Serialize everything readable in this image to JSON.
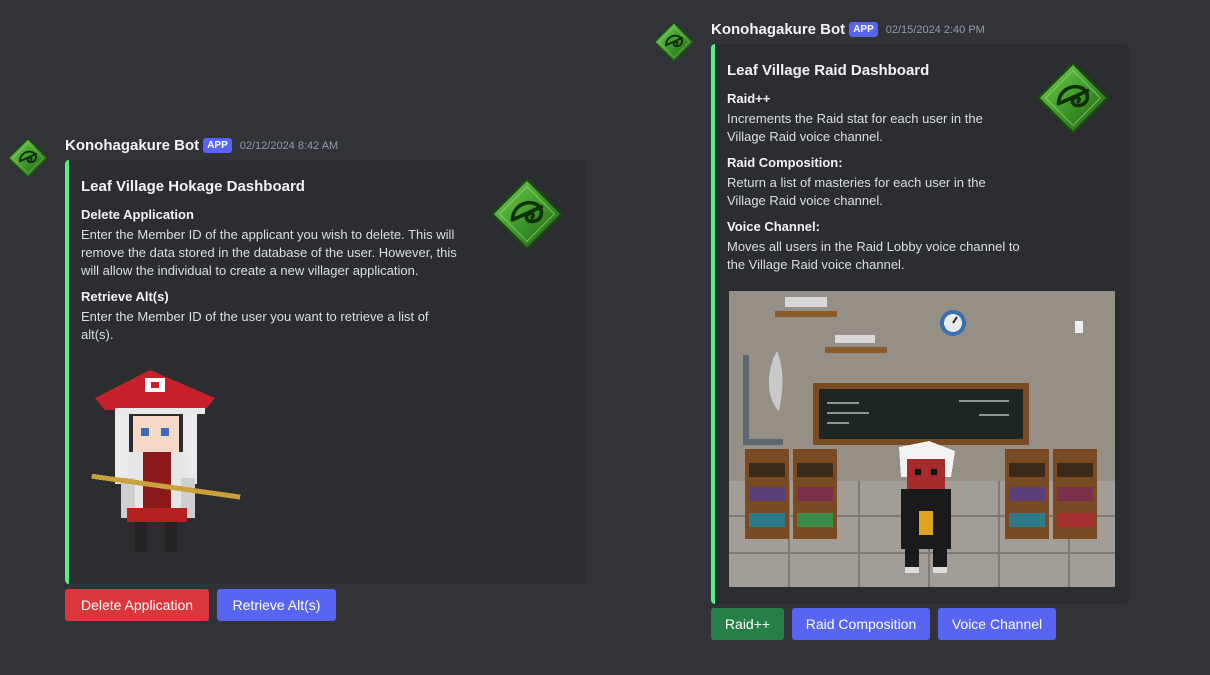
{
  "left_message": {
    "author": "Konohagakure Bot",
    "badge": "APP",
    "timestamp": "02/12/2024 8:42 AM",
    "embed": {
      "title": "Leaf Village Hokage Dashboard",
      "fields": [
        {
          "name": "Delete Application",
          "value": "Enter the Member ID of the applicant you wish to delete. This will remove the data stored in the database of the user. However, this will allow the individual to create a new villager application."
        },
        {
          "name": "Retrieve Alt(s)",
          "value": "Enter the Member ID of the user you want to retrieve a list of alt(s)."
        }
      ],
      "accent_color": "#57f287"
    },
    "buttons": [
      {
        "label": "Delete Application",
        "style": "danger"
      },
      {
        "label": "Retrieve Alt(s)",
        "style": "primary"
      }
    ]
  },
  "right_message": {
    "author": "Konohagakure Bot",
    "badge": "APP",
    "timestamp": "02/15/2024 2:40 PM",
    "embed": {
      "title": "Leaf Village Raid Dashboard",
      "fields": [
        {
          "name": "Raid++",
          "value": "Increments the Raid stat for each user in the Village Raid voice channel."
        },
        {
          "name": "Raid Composition:",
          "value": "Return a list of masteries for each user in the Village Raid voice channel."
        },
        {
          "name": "Voice Channel:",
          "value": "Moves all users in the Raid Lobby voice channel to the Village Raid voice channel."
        }
      ],
      "accent_color": "#57f287"
    },
    "buttons": [
      {
        "label": "Raid++",
        "style": "success"
      },
      {
        "label": "Raid Composition",
        "style": "primary"
      },
      {
        "label": "Voice Channel",
        "style": "primary"
      }
    ]
  },
  "icons": {
    "avatar": "leaf-village-emblem-icon",
    "thumbnail": "leaf-village-emblem-icon"
  },
  "colors": {
    "background": "#313338",
    "embed_bg": "#2b2d31",
    "danger": "#da373c",
    "primary": "#5865f2",
    "success": "#248046"
  }
}
